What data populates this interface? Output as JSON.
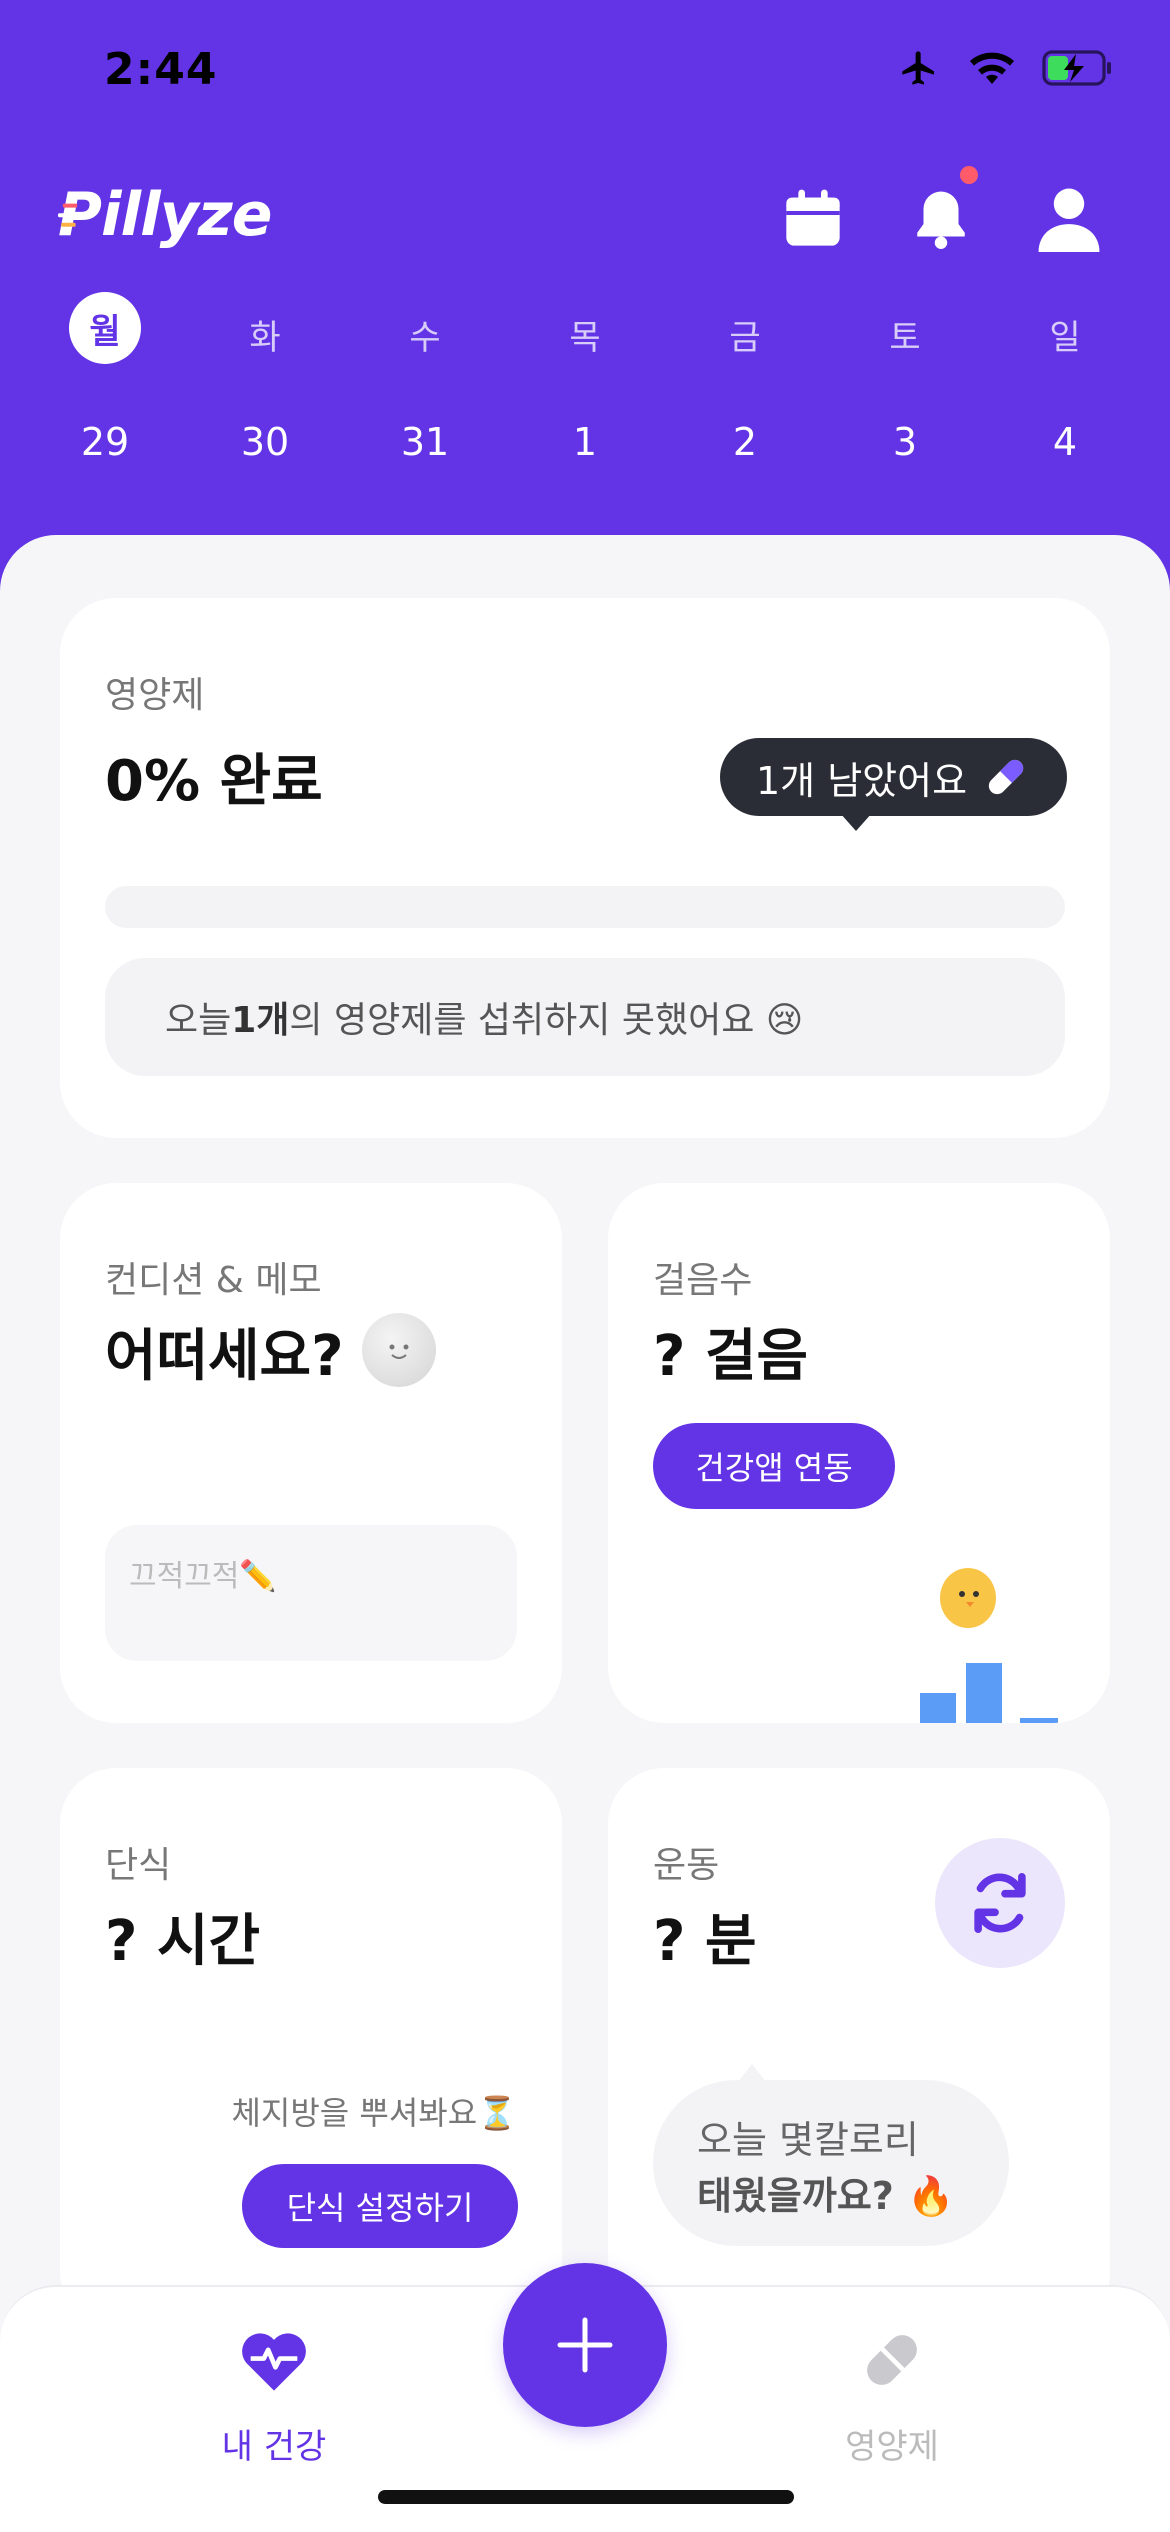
{
  "status_bar": {
    "time": "2:44"
  },
  "header": {
    "logo_text": "Pillyze",
    "actions": [
      {
        "name": "calendar-icon"
      },
      {
        "name": "bell-icon",
        "has_notification": true
      },
      {
        "name": "profile-icon"
      }
    ]
  },
  "week": {
    "days": [
      "월",
      "화",
      "수",
      "목",
      "금",
      "토",
      "일"
    ],
    "dates": [
      "29",
      "30",
      "31",
      "1",
      "2",
      "3",
      "4"
    ],
    "selected_index": 0
  },
  "supplements_card": {
    "title": "영양제",
    "value": "0% 완료",
    "progress_percent": 0,
    "tooltip": "1개 남았어요",
    "message_prefix": "오늘 ",
    "message_count": "1개",
    "message_suffix": "의 영양제를 섭취하지 못했어요 😢"
  },
  "condition_card": {
    "title": "컨디션 & 메모",
    "value": "어떠세요?",
    "memo_placeholder": "끄적끄적✏️"
  },
  "steps_card": {
    "title": "걸음수",
    "value": "? 걸음",
    "button": "건강앱 연동"
  },
  "fasting_card": {
    "title": "단식",
    "value": "? 시간",
    "hint": "체지방을 뿌셔봐요⏳",
    "button": "단식 설정하기"
  },
  "exercise_card": {
    "title": "운동",
    "value": "? 분",
    "bubble_line1": "오늘 몇칼로리",
    "bubble_line2": "태웠을까요? 🔥"
  },
  "tabbar": {
    "health_label": "내 건강",
    "supplements_label": "영양제"
  },
  "colors": {
    "brand": "#6334E6",
    "inactive": "#BBBBBB",
    "tooltip_bg": "#2B2D36"
  }
}
